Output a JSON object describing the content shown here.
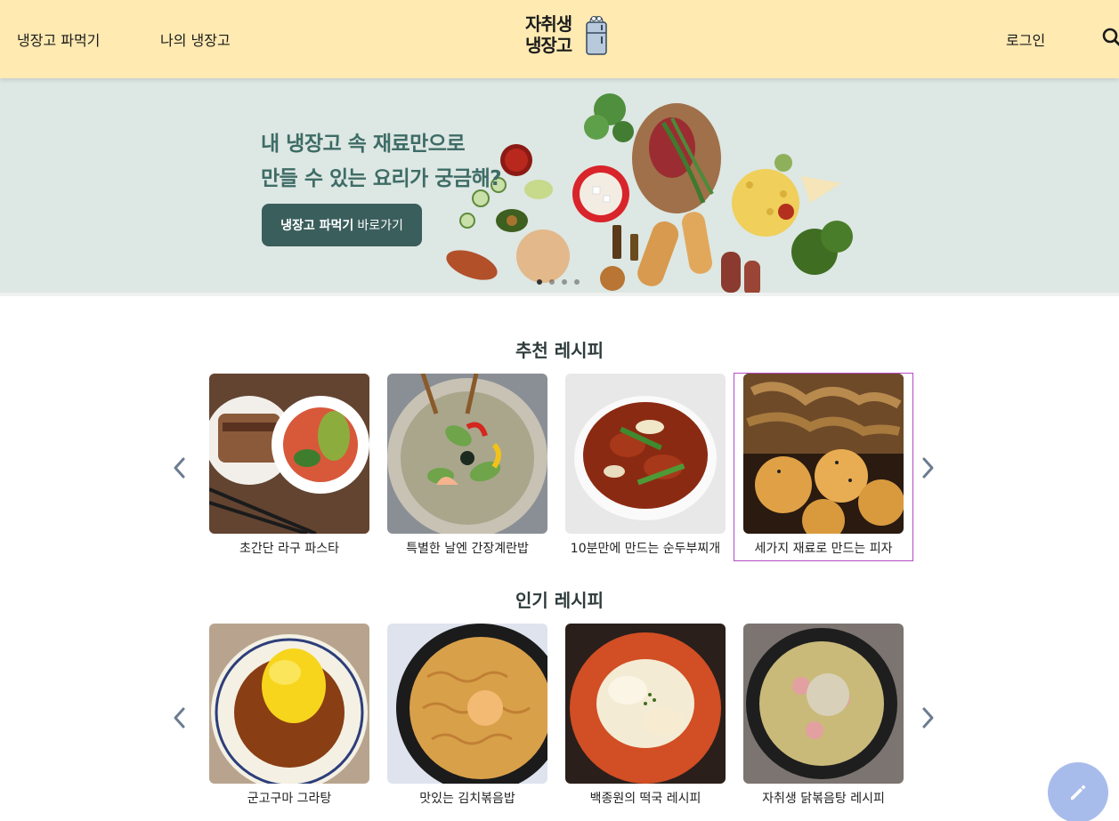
{
  "header": {
    "nav": {
      "fridge_hunt": "냉장고 파먹기",
      "my_fridge": "나의 냉장고",
      "login": "로그인"
    },
    "logo": {
      "line1": "자취생",
      "line2": "냉장고"
    },
    "search_icon": "search-icon",
    "background": "#ffeab2"
  },
  "hero": {
    "headline_line1": "내 냉장고 속 재료만으로",
    "headline_line2": "만들 수 있는 요리가 궁금해?",
    "cta_bold": "냉장고 파먹기",
    "cta_rest": "바로가기",
    "background": "#dde7e3",
    "cta_color": "#3a5e5c"
  },
  "sections": {
    "recommended": {
      "title": "추천 레시피",
      "items": [
        {
          "title": "초간단 라구 파스타"
        },
        {
          "title": "특별한 날엔 간장계란밥"
        },
        {
          "title": "10분만에 만드는 순두부찌개"
        },
        {
          "title": "세가지 재료로 만드는 피자"
        }
      ]
    },
    "popular": {
      "title": "인기 레시피",
      "items": [
        {
          "title": "군고구마 그라탕"
        },
        {
          "title": "맛있는 김치볶음밥"
        },
        {
          "title": "백종원의 떡국 레시피"
        },
        {
          "title": "자취생 닭볶음탕 레시피"
        }
      ]
    }
  },
  "fab": {
    "icon": "pencil-icon",
    "color": "#a8bcec"
  },
  "colors": {
    "title_text": "#2f3b3b",
    "arrow": "#6b7c8f",
    "highlight_border": "#b44cc4"
  }
}
